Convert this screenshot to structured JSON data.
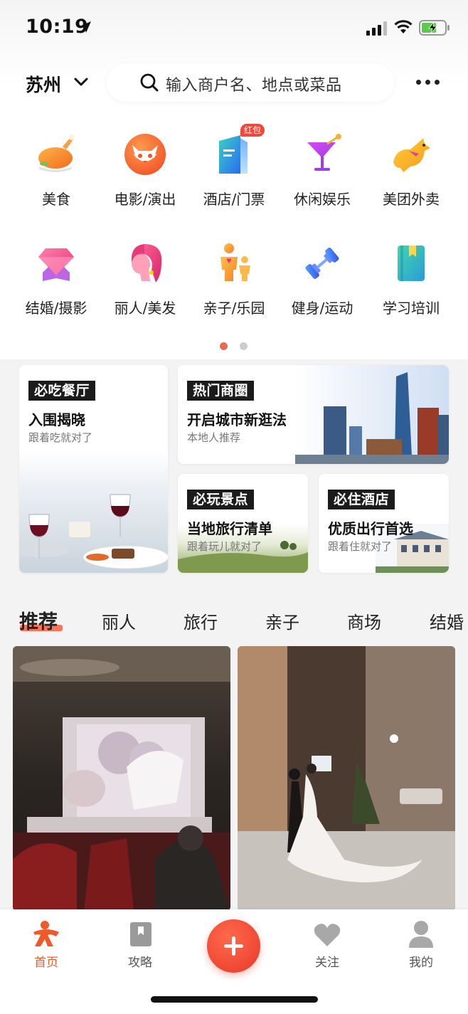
{
  "status_bar": {
    "time": "10:19"
  },
  "header": {
    "city": "苏州",
    "search_placeholder": "输入商户名、地点或菜品"
  },
  "categories_row1": [
    {
      "label": "美食",
      "icon": "roast-chicken-icon"
    },
    {
      "label": "电影/演出",
      "icon": "cat-face-icon"
    },
    {
      "label": "酒店/门票",
      "icon": "building-icon",
      "badge": "红包"
    },
    {
      "label": "休闲娱乐",
      "icon": "cocktail-icon"
    },
    {
      "label": "美团外卖",
      "icon": "kangaroo-icon"
    }
  ],
  "categories_row2": [
    {
      "label": "结婚/摄影",
      "icon": "diamond-icon"
    },
    {
      "label": "丽人/美发",
      "icon": "woman-hair-icon"
    },
    {
      "label": "亲子/乐园",
      "icon": "parent-child-icon"
    },
    {
      "label": "健身/运动",
      "icon": "dumbbell-icon"
    },
    {
      "label": "学习培训",
      "icon": "book-icon"
    }
  ],
  "pager": {
    "pages": 2,
    "active": 1
  },
  "promo": {
    "restaurant": {
      "tag": "必吃餐厅",
      "title": "入围揭晓",
      "subtitle": "跟着吃就对了"
    },
    "business": {
      "tag": "热门商圈",
      "title": "开启城市新逛法",
      "subtitle": "本地人推荐"
    },
    "scenic": {
      "tag": "必玩景点",
      "title": "当地旅行清单",
      "subtitle": "跟着玩儿就对了"
    },
    "hotel": {
      "tag": "必住酒店",
      "title": "优质出行首选",
      "subtitle": "跟着住就对了"
    }
  },
  "tabs": [
    "推荐",
    "丽人",
    "旅行",
    "亲子",
    "商场",
    "结婚"
  ],
  "active_tab": "推荐",
  "bottom_nav": {
    "home": "首页",
    "guide": "攻略",
    "follow": "关注",
    "mine": "我的"
  },
  "colors": {
    "accent": "#ff5a3c",
    "tag_bg": "#1b1b1b",
    "dot_active": "#e96a4f",
    "dot_inactive": "#cccccc"
  }
}
